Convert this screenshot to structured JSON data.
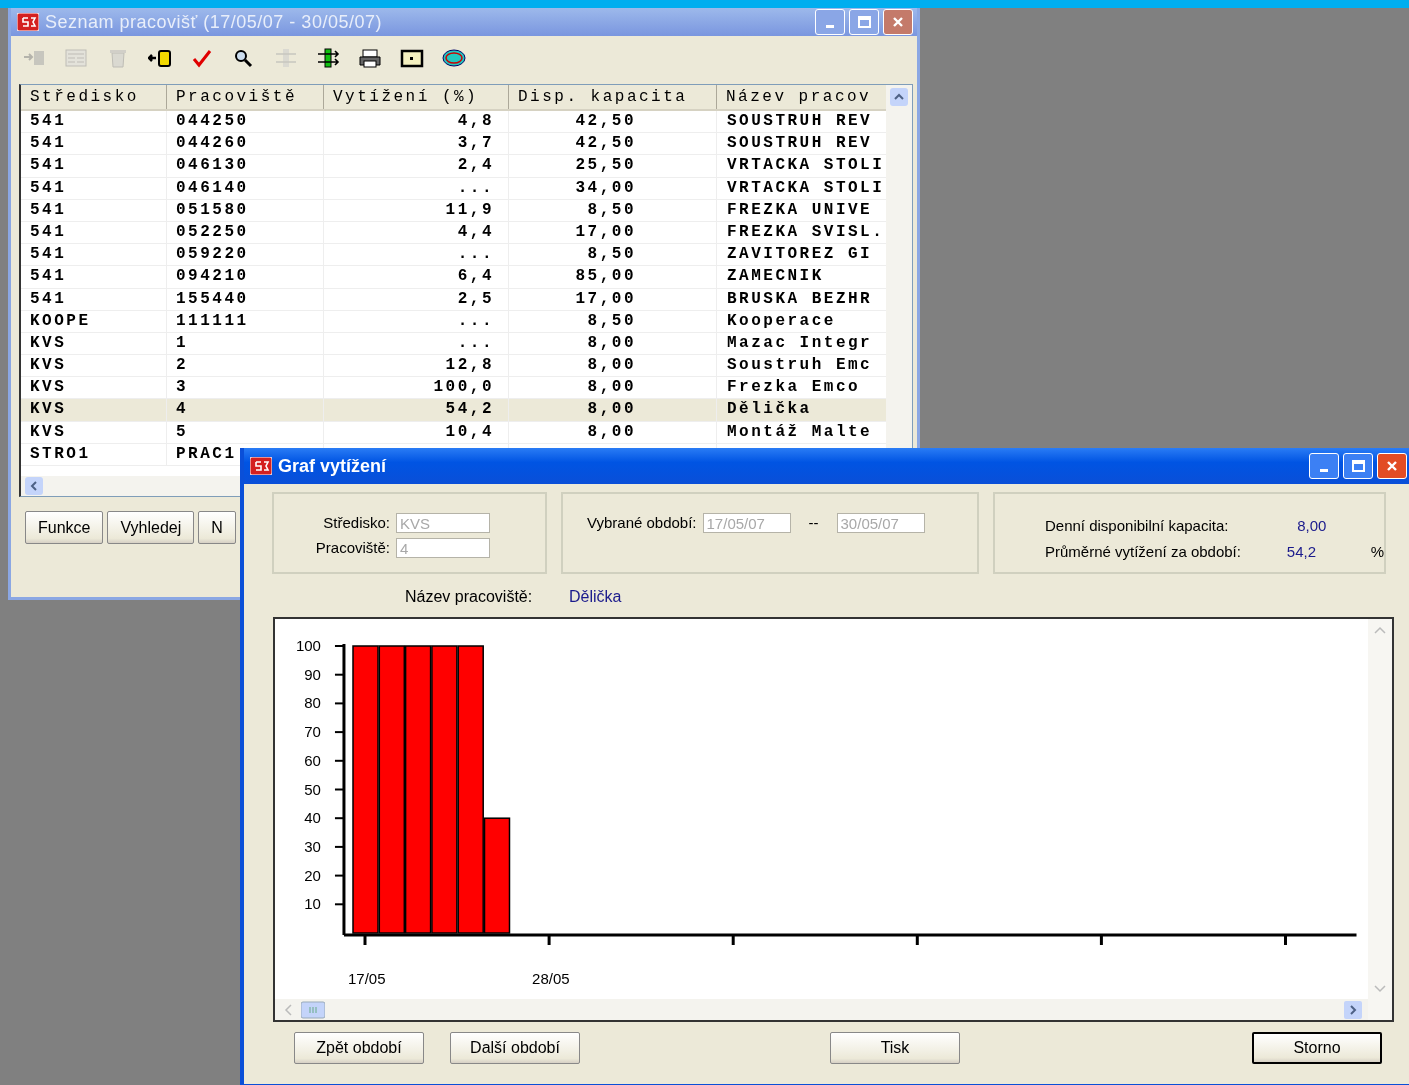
{
  "list_window": {
    "title": "Seznam pracovišť (17/05/07 - 30/05/07)",
    "active": false,
    "toolbar": [
      {
        "disabled": true
      },
      {
        "disabled": true
      },
      {
        "disabled": true
      },
      {
        "disabled": false
      },
      {
        "disabled": false
      },
      {
        "disabled": false
      },
      {
        "disabled": true
      },
      {
        "disabled": false
      },
      {
        "disabled": false
      },
      {
        "disabled": false
      },
      {
        "disabled": false
      }
    ],
    "table": {
      "columns": [
        "Středisko",
        "Pracoviště",
        "Vytížení (%)",
        "Disp. kapacita",
        "Název pracov"
      ],
      "rows": [
        {
          "cells": [
            "541",
            "044250",
            "4,8",
            "42,50",
            "SOUSTRUH REV"
          ],
          "selected": false
        },
        {
          "cells": [
            "541",
            "044260",
            "3,7",
            "42,50",
            "SOUSTRUH REV"
          ],
          "selected": false
        },
        {
          "cells": [
            "541",
            "046130",
            "2,4",
            "25,50",
            "VRTACKA STOLI"
          ],
          "selected": false
        },
        {
          "cells": [
            "541",
            "046140",
            "...",
            "34,00",
            "VRTACKA STOLI"
          ],
          "selected": false
        },
        {
          "cells": [
            "541",
            "051580",
            "11,9",
            "8,50",
            "FREZKA UNIVE"
          ],
          "selected": false
        },
        {
          "cells": [
            "541",
            "052250",
            "4,4",
            "17,00",
            "FREZKA SVISL."
          ],
          "selected": false
        },
        {
          "cells": [
            "541",
            "059220",
            "...",
            "8,50",
            "ZAVITOREZ GI"
          ],
          "selected": false
        },
        {
          "cells": [
            "541",
            "094210",
            "6,4",
            "85,00",
            "ZAMECNIK"
          ],
          "selected": false
        },
        {
          "cells": [
            "541",
            "155440",
            "2,5",
            "17,00",
            "BRUSKA BEZHR"
          ],
          "selected": false
        },
        {
          "cells": [
            "KOOPE",
            "111111",
            "...",
            "8,50",
            "Kooperace"
          ],
          "selected": false
        },
        {
          "cells": [
            "KVS",
            "1",
            "...",
            "8,00",
            "Mazac Integr"
          ],
          "selected": false
        },
        {
          "cells": [
            "KVS",
            "2",
            "12,8",
            "8,00",
            "Soustruh Emc"
          ],
          "selected": false
        },
        {
          "cells": [
            "KVS",
            "3",
            "100,0",
            "8,00",
            "Frezka Emco"
          ],
          "selected": false
        },
        {
          "cells": [
            "KVS",
            "4",
            "54,2",
            "8,00",
            "Dělička"
          ],
          "selected": true
        },
        {
          "cells": [
            "KVS",
            "5",
            "10,4",
            "8,00",
            "Montáž Malte"
          ],
          "selected": false
        },
        {
          "cells": [
            "STRO1",
            "PRAC1"
          ],
          "selected": false
        }
      ]
    },
    "buttons": [
      "Funkce",
      "Vyhledej",
      "N"
    ]
  },
  "graph_window": {
    "title": "Graf vytížení",
    "active": true,
    "stredisko": {
      "label": "Středisko:",
      "value": "KVS",
      "disabled": true
    },
    "pracoviste": {
      "label": "Pracoviště:",
      "value": "4",
      "disabled": true
    },
    "period": {
      "label": "Vybrané období:",
      "from": "17/05/07",
      "separator": "--",
      "to": "30/05/07"
    },
    "daily_capacity": {
      "label": "Denní disponibilní kapacita:",
      "value": "8,00"
    },
    "average_load": {
      "label": "Průměrné vytížení za období:",
      "value": "54,2",
      "unit": "%"
    },
    "workplace_name": {
      "label": "Název pracoviště:",
      "value": "Dělička"
    },
    "chart_data": {
      "type": "bar",
      "categories": [
        "17/05",
        null,
        null,
        null,
        null,
        null,
        null,
        "28/05",
        null,
        null,
        null,
        null,
        null,
        null,
        null,
        null,
        null,
        null,
        null,
        null,
        null,
        null,
        null,
        null,
        null,
        null,
        null,
        null,
        null,
        null,
        null,
        null,
        null,
        null,
        null,
        null,
        null,
        null
      ],
      "values": [
        100,
        100,
        100,
        100,
        100,
        40,
        null,
        null,
        null,
        null,
        null,
        null,
        null,
        null,
        null,
        null,
        null,
        null,
        null,
        null,
        null,
        null,
        null,
        null,
        null,
        null,
        null,
        null,
        null,
        null,
        null,
        null,
        null,
        null,
        null,
        null,
        null,
        null
      ],
      "ylim": [
        0,
        100
      ],
      "yticks": [
        10,
        20,
        30,
        40,
        50,
        60,
        70,
        80,
        90,
        100
      ]
    },
    "buttons": [
      {
        "label": "Zpět období",
        "default": false
      },
      {
        "label": "Další období",
        "default": false
      },
      {
        "label": "Tisk",
        "default": false
      },
      {
        "label": "Storno",
        "default": true
      }
    ]
  }
}
